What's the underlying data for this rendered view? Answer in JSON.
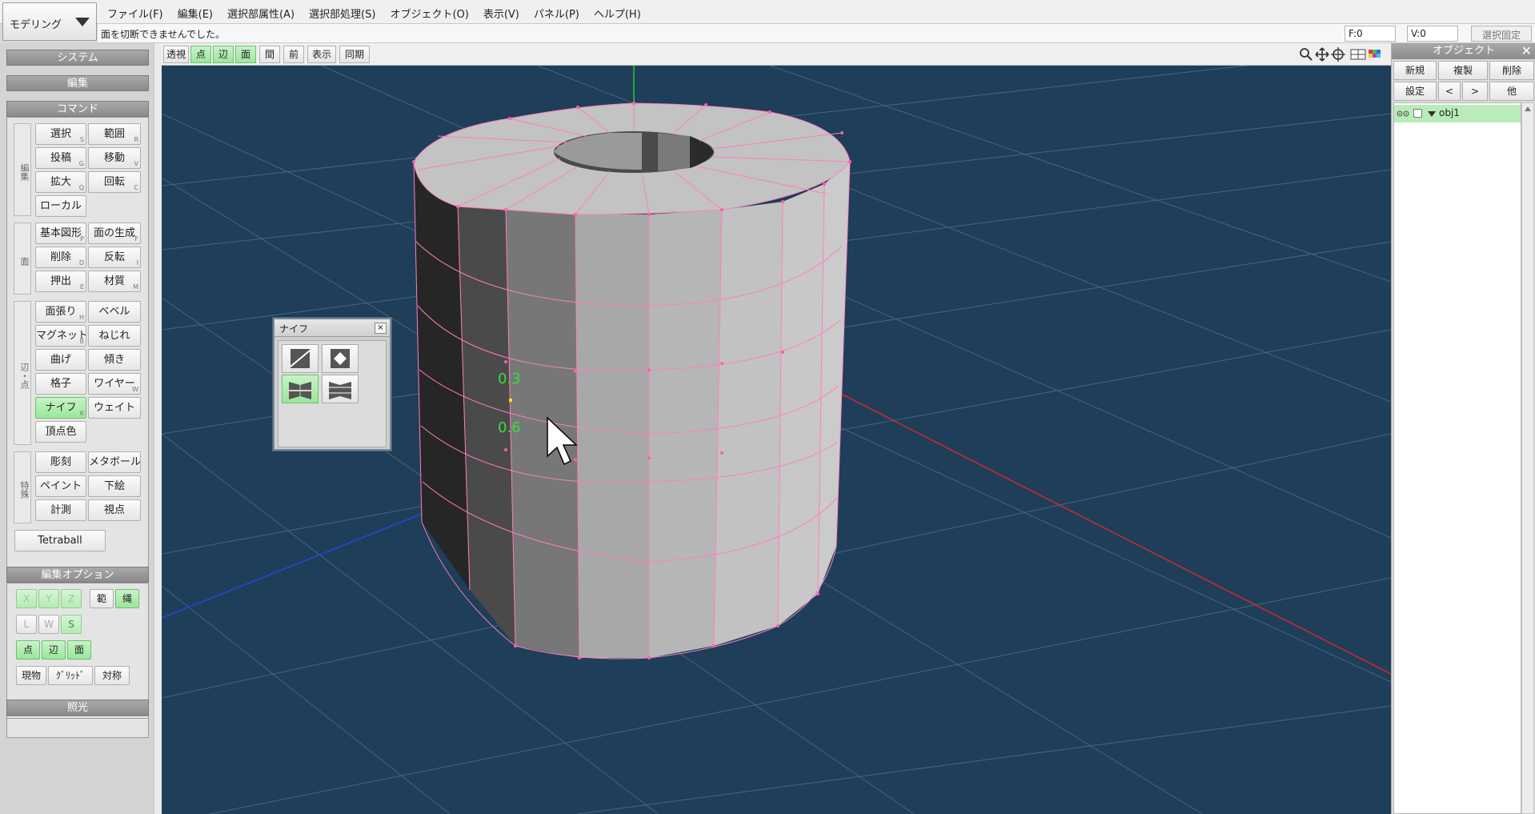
{
  "mode": {
    "label": "モデリング"
  },
  "menu": [
    "ファイル(F)",
    "編集(E)",
    "選択部属性(A)",
    "選択部処理(S)",
    "オブジェクト(O)",
    "表示(V)",
    "パネル(P)",
    "ヘルプ(H)"
  ],
  "status": {
    "message": "面を切断できませんでした。",
    "faces": "F:0",
    "vertices": "V:0",
    "selection_lock": "選択固定"
  },
  "left": {
    "system": "システム",
    "edit": "編集",
    "command": "コマンド",
    "groups": {
      "edit": "編集",
      "face": "面",
      "edge_point": "辺・点",
      "special": "特殊"
    },
    "cmd": {
      "select": "選択",
      "select_key": "S",
      "range": "範囲",
      "range_key": "R",
      "project": "投稿",
      "project_key": "G",
      "move": "移動",
      "move_key": "V",
      "scale": "拡大",
      "scale_key": "Q",
      "rotate": "回転",
      "rotate_key": "C",
      "local": "ローカル",
      "primitive": "基本図形",
      "primitive_key": "P",
      "face_gen": "面の生成",
      "face_gen_key": "F",
      "delete": "削除",
      "delete_key": "D",
      "flip": "反転",
      "flip_key": "I",
      "extrude": "押出",
      "extrude_key": "E",
      "material": "材質",
      "material_key": "M",
      "face_paste": "面張り",
      "face_paste_key": "H",
      "bevel": "ベベル",
      "magnet": "マグネット",
      "magnet_key": "B",
      "twist": "ねじれ",
      "bend": "曲げ",
      "tilt": "傾き",
      "lattice": "格子",
      "wire": "ワイヤー",
      "wire_key": "W",
      "knife": "ナイフ",
      "knife_key": "K",
      "weight": "ウェイト",
      "vertex_color": "頂点色",
      "sculpt": "彫刻",
      "metaball": "メタボール粘",
      "paint": "ペイント",
      "underlay": "下絵",
      "measure": "計測",
      "viewpoint": "視点",
      "tetraball": "Tetraball"
    },
    "edit_options": "編集オプション",
    "opt": {
      "x": "X",
      "y": "Y",
      "z": "Z",
      "range": "範",
      "rope": "縄",
      "l": "L",
      "w": "W",
      "s": "S",
      "point": "点",
      "edge": "辺",
      "face": "面",
      "current": "現物",
      "grid": "ｸﾞﾘｯﾄﾞ",
      "symmetry": "対称"
    },
    "lighting": "照光"
  },
  "viewport_toolbar": {
    "perspective": "透視",
    "point": "点",
    "edge": "辺",
    "face": "面",
    "between": "間",
    "front": "前",
    "display": "表示",
    "sync": "同期"
  },
  "viewport": {
    "knife_labels": [
      "0.3",
      "0.6"
    ]
  },
  "knife_dialog": {
    "title": "ナイフ",
    "close": "×"
  },
  "right": {
    "objects_title": "オブジェクト",
    "close": "✕",
    "new": "新規",
    "duplicate": "複製",
    "delete": "削除",
    "settings": "設定",
    "prev": "<",
    "next": ">",
    "other": "他",
    "objects": [
      {
        "name": "obj1"
      }
    ]
  },
  "colors": {
    "viewport_bg": "#1e3e5a",
    "selected_green": "#9be69b",
    "wire_pink": "#ff7fbf",
    "knife_text": "#3ddc3d"
  }
}
